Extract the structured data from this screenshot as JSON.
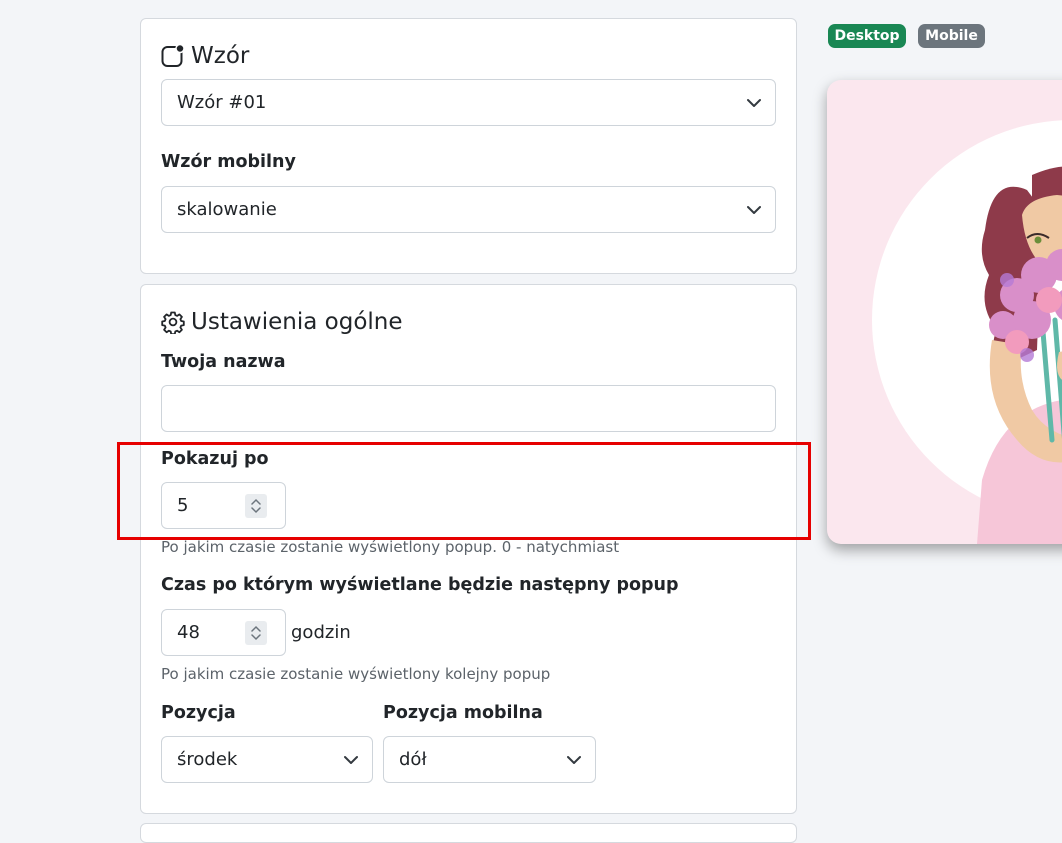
{
  "pattern_card": {
    "title": "Wzór",
    "pattern_select": {
      "value": "Wzór #01"
    },
    "mobile_label": "Wzór mobilny",
    "mobile_select": {
      "value": "skalowanie"
    }
  },
  "general_card": {
    "title": "Ustawienia ogólne",
    "name_label": "Twoja nazwa",
    "name_value": "",
    "show_after_label": "Pokazuj po",
    "show_after_value": "5",
    "show_after_help": "Po jakim czasie zostanie wyświetlony popup. 0 - natychmiast",
    "next_popup_label": "Czas po którym wyświetlane będzie następny popup",
    "next_popup_value": "48",
    "next_popup_unit": "godzin",
    "next_popup_help": "Po jakim czasie zostanie wyświetlony kolejny popup",
    "position_label": "Pozycja",
    "position_value": "środek",
    "mobile_position_label": "Pozycja mobilna",
    "mobile_position_value": "dół"
  },
  "preview": {
    "desktop_badge": "Desktop",
    "mobile_badge": "Mobile"
  },
  "colors": {
    "highlight": "#e60000",
    "desktop_badge": "#198754",
    "mobile_badge": "#6c757d",
    "preview_bg": "#fbe7ee"
  }
}
